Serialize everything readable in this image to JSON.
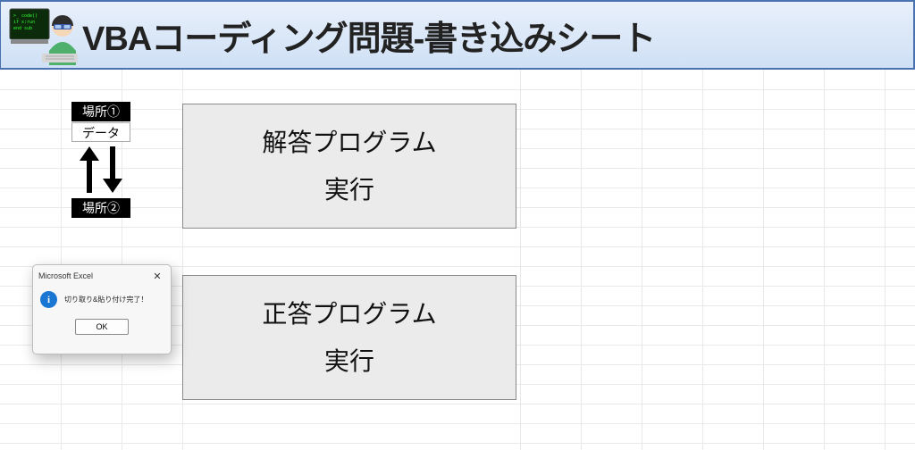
{
  "header": {
    "title": "VBAコーディング問題-書き込みシート"
  },
  "labels": {
    "location1": "場所①",
    "location2": "場所②",
    "data": "データ"
  },
  "buttons": {
    "answer": {
      "line1": "解答プログラム",
      "line2": "実行"
    },
    "correct": {
      "line1": "正答プログラム",
      "line2": "実行"
    }
  },
  "dialog": {
    "title": "Microsoft Excel",
    "message": "切り取り&貼り付け完了！",
    "ok": "OK",
    "close": "✕"
  }
}
